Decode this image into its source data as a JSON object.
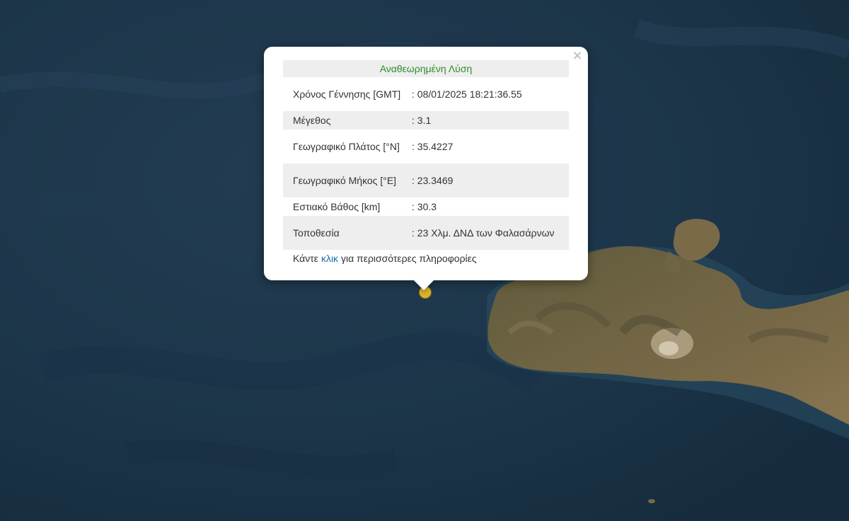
{
  "map": {
    "colors": {
      "sea": "#1b3347",
      "land": "#6b5e3e",
      "marker": "#d9b52a",
      "header_text": "#2e8b2e",
      "link": "#1a6fa8"
    }
  },
  "popup": {
    "close_glyph": "×",
    "header": "Αναθεωρημένη Λύση",
    "rows": [
      {
        "label": "Χρόνος Γέννησης [GMT]",
        "value": ": 08/01/2025 18:21:36.55"
      },
      {
        "label": "Μέγεθος",
        "value": ": 3.1"
      },
      {
        "label": "Γεωγραφικό Πλάτος [°N]",
        "value": ": 35.4227"
      },
      {
        "label": "Γεωγραφικό Μήκος [°E]",
        "value": ": 23.3469"
      },
      {
        "label": "Εστιακό Βάθος [km]",
        "value": ": 30.3"
      },
      {
        "label": "Τοποθεσία",
        "value": ": 23 Χλμ. ΔΝΔ των Φαλασάρνων"
      }
    ],
    "footer_prefix": "Κάντε",
    "footer_link": "κλικ",
    "footer_suffix": "για περισσότερες πληροφορίες"
  }
}
